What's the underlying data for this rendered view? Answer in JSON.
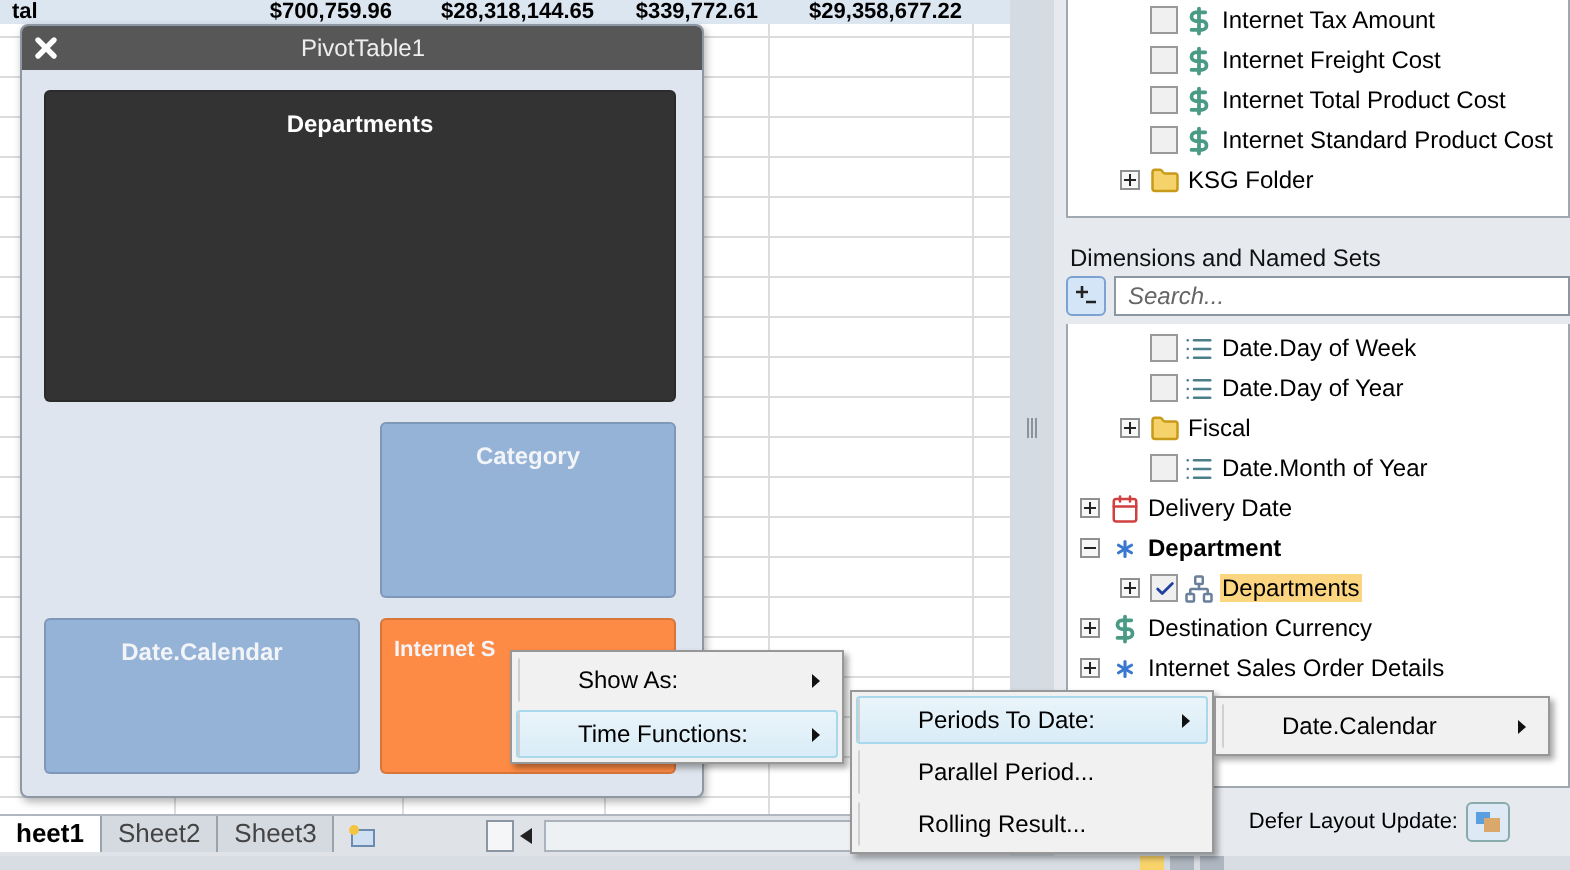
{
  "spreadsheet": {
    "total_row": {
      "label": "tal",
      "values": [
        "$700,759.96",
        "$28,318,144.65",
        "$339,772.61",
        "$29,358,677.22"
      ]
    },
    "sheet_tabs": [
      {
        "label": "heet1",
        "selected": true
      },
      {
        "label": "Sheet2",
        "selected": false
      },
      {
        "label": "Sheet3",
        "selected": false
      }
    ]
  },
  "pivot_window": {
    "title": "PivotTable1",
    "tiles": [
      {
        "label": "Departments",
        "color": "#333333"
      },
      {
        "label": "Category",
        "color": "#95b3d7"
      },
      {
        "label": "Date.Calendar",
        "color": "#95b3d7"
      },
      {
        "label": "Internet S",
        "color": "#fd8a45"
      }
    ]
  },
  "field_list": {
    "measures": [
      {
        "label": "Internet Tax Amount",
        "kind": "measure",
        "checked": false
      },
      {
        "label": "Internet Freight Cost",
        "kind": "measure",
        "checked": false
      },
      {
        "label": "Internet Total Product Cost",
        "kind": "measure",
        "checked": false
      },
      {
        "label": "Internet Standard Product Cost",
        "kind": "measure",
        "checked": false
      },
      {
        "label": "KSG Folder",
        "kind": "folder",
        "expanded": false
      }
    ],
    "dimensions_label": "Dimensions and Named Sets",
    "search": {
      "placeholder": "Search..."
    },
    "dimensions": {
      "continued_children": [
        {
          "label": "Date.Day of Week",
          "kind": "attribute",
          "checked": false
        },
        {
          "label": "Date.Day of Year",
          "kind": "attribute",
          "checked": false
        },
        {
          "label": "Fiscal",
          "kind": "folder",
          "expanded": false
        },
        {
          "label": "Date.Month of Year",
          "kind": "attribute",
          "checked": false
        }
      ],
      "items": [
        {
          "label": "Delivery Date",
          "kind": "date",
          "expanded": false
        },
        {
          "label": "Department",
          "kind": "dimension",
          "expanded": true,
          "bold": true,
          "children": [
            {
              "label": "Departments",
              "kind": "hierarchy",
              "expanded": false,
              "checked": true,
              "highlighted": true
            }
          ]
        },
        {
          "label": "Destination Currency",
          "kind": "measure",
          "expanded": false
        },
        {
          "label": "Internet Sales Order Details",
          "kind": "dimension",
          "expanded": false
        }
      ]
    },
    "defer_label": "Defer Layout Update:"
  },
  "context_menus": [
    {
      "items": [
        {
          "label": "Show As:",
          "submenu": true,
          "selected": false
        },
        {
          "label": "Time Functions:",
          "submenu": true,
          "selected": true
        }
      ]
    },
    {
      "items": [
        {
          "label": "Periods To Date:",
          "submenu": true,
          "selected": true
        },
        {
          "label": "Parallel Period...",
          "submenu": false,
          "selected": false
        },
        {
          "label": "Rolling Result...",
          "submenu": false,
          "selected": false
        }
      ]
    },
    {
      "items": [
        {
          "label": "Date.Calendar",
          "submenu": true,
          "selected": false
        }
      ]
    }
  ]
}
